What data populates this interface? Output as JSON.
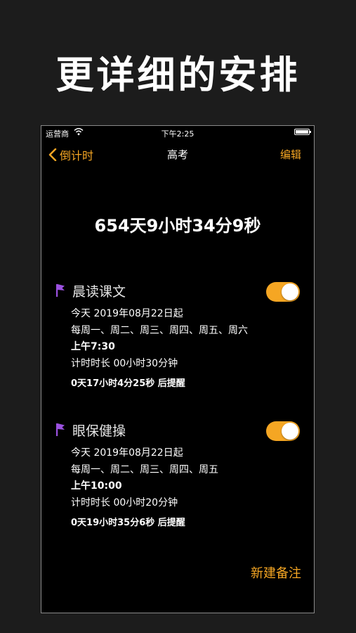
{
  "promo": {
    "title": "更详细的安排"
  },
  "status_bar": {
    "carrier": "运营商",
    "time": "下午2:25"
  },
  "nav": {
    "back_label": "倒计时",
    "title": "高考",
    "edit_label": "编辑"
  },
  "countdown": {
    "text": "654天9小时34分9秒"
  },
  "reminders": [
    {
      "title": "晨读课文",
      "enabled": true,
      "start": "今天 2019年08月22日起",
      "repeat": "每周一、周二、周三、周四、周五、周六",
      "time": "上午7:30",
      "duration": "计时时长 00小时30分钟",
      "alert": "0天17小时4分25秒 后提醒"
    },
    {
      "title": "眼保健操",
      "enabled": true,
      "start": "今天 2019年08月22日起",
      "repeat": "每周一、周二、周三、周四、周五",
      "time": "上午10:00",
      "duration": "计时时长 00小时20分钟",
      "alert": "0天19小时35分6秒 后提醒"
    }
  ],
  "actions": {
    "new_note": "新建备注"
  },
  "colors": {
    "accent": "#f5a623",
    "flag": "#9b51e0",
    "background": "#000000"
  }
}
